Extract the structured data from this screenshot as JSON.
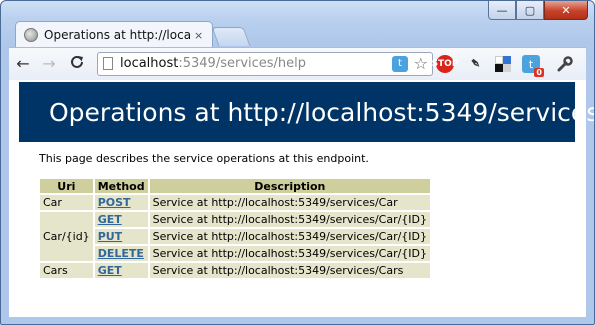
{
  "window": {
    "controls": {
      "minimize": "—",
      "maximize": "▢",
      "close": "✕"
    }
  },
  "tab": {
    "title": "Operations at http://localhost",
    "close": "×"
  },
  "toolbar": {
    "back": "←",
    "forward": "→",
    "reload": "C",
    "url_host": "localhost",
    "url_rest": ":5349/services/help",
    "star": "☆",
    "stop_label": "STOP",
    "twitter_badge": "0",
    "wrench": "🔧"
  },
  "page": {
    "heading": "Operations at http://localhost:5349/services",
    "intro": "This page describes the service operations at this endpoint.",
    "table": {
      "headers": [
        "Uri",
        "Method",
        "Description"
      ],
      "rows": [
        {
          "uri": "Car",
          "method": "POST",
          "description": "Service at http://localhost:5349/services/Car"
        },
        {
          "uri": "Car/{id}",
          "method": "GET",
          "description": "Service at http://localhost:5349/services/Car/{ID}"
        },
        {
          "uri": "",
          "method": "PUT",
          "description": "Service at http://localhost:5349/services/Car/{ID}"
        },
        {
          "uri": "",
          "method": "DELETE",
          "description": "Service at http://localhost:5349/services/Car/{ID}"
        },
        {
          "uri": "Cars",
          "method": "GET",
          "description": "Service at http://localhost:5349/services/Cars"
        }
      ]
    }
  },
  "colors": {
    "heading_bg": "#003366",
    "table_header_bg": "#cecf9c",
    "table_cell_bg": "#e5e5cc",
    "link": "#336699"
  }
}
